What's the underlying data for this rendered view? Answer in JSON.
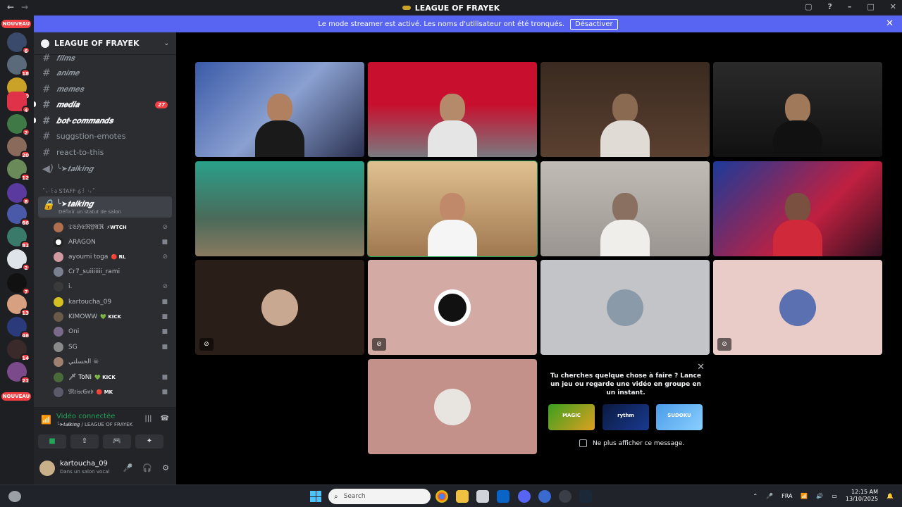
{
  "window": {
    "title": "LEAGUE OF FRAYEK"
  },
  "banner": {
    "text": "Le mode streamer est activé. Les noms d'utilisateur ont été tronqués.",
    "button": "Désactiver"
  },
  "guilds": {
    "nouveau_label": "NOUVEAU",
    "badges": [
      "6",
      "18",
      "10",
      "4",
      "2",
      "20",
      "12",
      "8",
      "66",
      "81",
      "2",
      "7",
      "13",
      "46",
      "14",
      "21"
    ]
  },
  "server": {
    "name": "LEAGUE OF FRAYEK"
  },
  "channels": [
    {
      "label": "𝒇𝒊𝒍𝒎𝒔",
      "style": "italic"
    },
    {
      "label": "𝒂𝒏𝒊𝒎𝒆",
      "style": "italic"
    },
    {
      "label": "𝒎𝒆𝒎𝒆𝒔",
      "style": "italic"
    },
    {
      "label": "𝒎𝒆𝒅𝒊𝒂",
      "style": "bold",
      "mentions": "27"
    },
    {
      "label": "𝒃𝒐𝒕-𝒄𝒐𝒎𝒎𝒂𝒏𝒅𝒔",
      "style": "bold"
    },
    {
      "label": "suggstion-emotes",
      "style": "normal"
    },
    {
      "label": "react-to-this",
      "style": "normal"
    },
    {
      "label": "╰➤𝒕𝒂𝒍𝒌𝒊𝒏𝒈",
      "style": "italic"
    }
  ],
  "category": "˚₊‧꒰ა STAFF ໒꒱ ‧₊˚",
  "active_voice_channel": {
    "label": "╰➤𝒕𝒂𝒍𝒌𝒊𝒏𝒈",
    "sub": "Définir un statut de salon"
  },
  "voice_users": [
    {
      "name": "𝔗𝔈ℌ𝔈ℜ𝔜𝔄ℜ",
      "tag": "⚡WTCH"
    },
    {
      "name": "ARAGON",
      "tag": ""
    },
    {
      "name": "ayoumi toga",
      "tag": "🔴 RL"
    },
    {
      "name": "Cr7_suiiiiiii_rami",
      "tag": ""
    },
    {
      "name": "i.",
      "tag": ""
    },
    {
      "name": "kartoucha_09",
      "tag": ""
    },
    {
      "name": "KIMOWW",
      "tag": "💚 KICK"
    },
    {
      "name": "Oni",
      "tag": ""
    },
    {
      "name": "SG",
      "tag": ""
    },
    {
      "name": "الحسلتي ☠",
      "tag": ""
    },
    {
      "name": "🗡 ToNi",
      "tag": "💚 KICK"
    },
    {
      "name": "𝔐𝔯𝔦𝔰𝔢𝔊𝔫𝔡",
      "tag": "🔴 MK"
    }
  ],
  "voice_panel": {
    "status": "Vidéo connectée",
    "sub": "╰➤𝒕𝒂𝒍𝒌𝒊𝒏𝒈 / LEAGUE OF FRAYEK"
  },
  "user_panel": {
    "name": "kartoucha_09",
    "status": "Dans un salon vocal"
  },
  "activity": {
    "title": "Tu cherches quelque chose à faire ? Lance un jeu ou regarde une vidéo en groupe en un instant.",
    "cards": [
      "MAGIC",
      "rythm",
      "SUDOKU"
    ],
    "checkbox": "Ne plus afficher ce message."
  },
  "taskbar": {
    "search_placeholder": "Search",
    "lang": "FRA",
    "time": "12:15 AM",
    "date": "13/10/2025"
  },
  "colors": {
    "blurple": "#5865f2",
    "green": "#23a55a",
    "red": "#f23f43"
  }
}
